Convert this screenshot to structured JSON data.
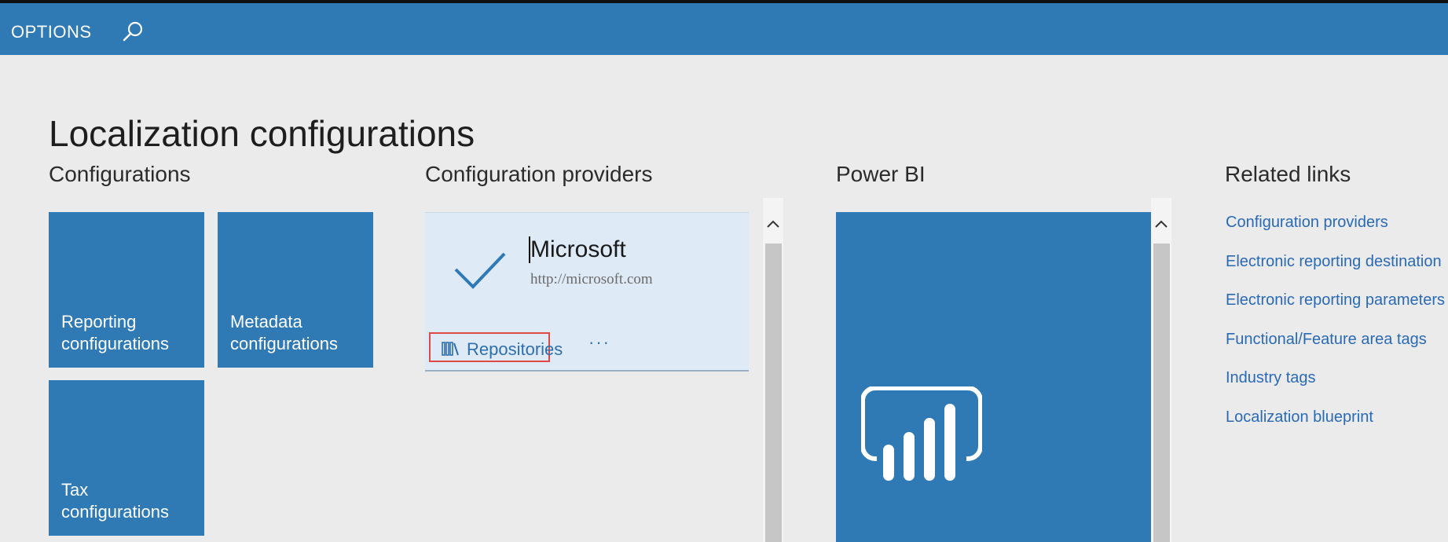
{
  "topbar": {
    "options_label": "OPTIONS",
    "search_icon": "search-icon"
  },
  "page": {
    "title": "Localization configurations"
  },
  "sections": {
    "configurations": "Configurations",
    "providers": "Configuration providers",
    "powerbi": "Power BI",
    "related_links": "Related links"
  },
  "configuration_tiles": [
    {
      "label": "Reporting\nconfigurations"
    },
    {
      "label": "Metadata\nconfigurations"
    },
    {
      "label": "Tax\nconfigurations"
    }
  ],
  "provider": {
    "name": "Microsoft",
    "url": "http://microsoft.com",
    "status_icon": "checkmark-icon",
    "repositories_label": "Repositories",
    "repositories_icon": "library-icon",
    "more_label": "···"
  },
  "powerbi": {
    "icon": "powerbi-chart-icon"
  },
  "related_links": [
    "Configuration providers",
    "Electronic reporting destination",
    "Electronic reporting parameters",
    "Functional/Feature area tags",
    "Industry tags",
    "Localization blueprint"
  ],
  "colors": {
    "brand": "#2f79b5",
    "background": "#ebebeb",
    "card": "#deeaf6",
    "link": "#2a6ab4",
    "highlight": "#e04848"
  }
}
